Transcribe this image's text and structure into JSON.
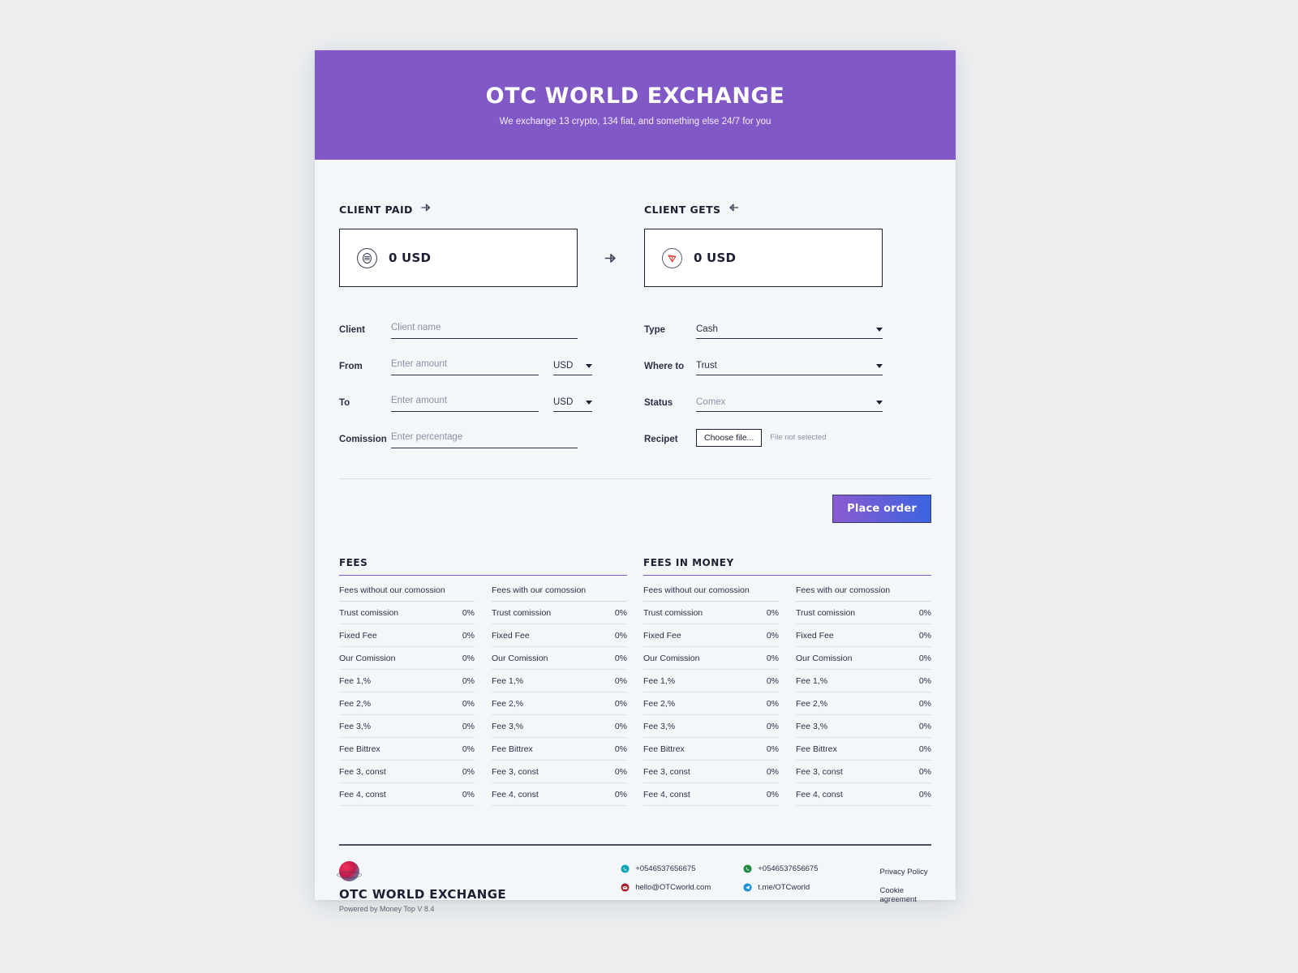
{
  "hero": {
    "title": "OTC WORLD EXCHANGE",
    "subtitle": "We exchange 13 crypto, 134 fiat, and something else 24/7 for you",
    "bg_color": "#8059c7"
  },
  "exchange": {
    "paid": {
      "label": "CLIENT PAID",
      "icon": "arrow-right-icon",
      "coin_icon": "stack-coin-icon",
      "amount": "0 USD"
    },
    "gets": {
      "label": "CLIENT GETS",
      "icon": "arrow-left-icon",
      "coin_icon": "tron-trx-icon",
      "amount": "0 USD"
    },
    "swap_icon": "arrow-right-icon"
  },
  "form_left": [
    {
      "label": "Client",
      "placeholder": "Client name",
      "value": "",
      "unit": null
    },
    {
      "label": "From",
      "placeholder": "Enter amount",
      "value": "",
      "unit": "USD"
    },
    {
      "label": "To",
      "placeholder": "Enter amount",
      "value": "",
      "unit": "USD"
    },
    {
      "label": "Comission",
      "placeholder": "Enter percentage",
      "value": "",
      "unit": null
    }
  ],
  "form_right": {
    "type": {
      "label": "Type",
      "value": "Cash"
    },
    "where_to": {
      "label": "Where to",
      "value": "Trust"
    },
    "status": {
      "label": "Status",
      "value": "Comex"
    },
    "recipet": {
      "label": "Recipet",
      "button": "Choose file...",
      "note": "File not selected"
    }
  },
  "actions": {
    "place_order": "Place order",
    "gradient_from": "#8b5bd0",
    "gradient_to": "#3b63e0"
  },
  "fees_sections": [
    {
      "title": "FEES",
      "columns": [
        {
          "header": "Fees without our comossion",
          "rows": [
            {
              "name": "Trust comission",
              "value": "0%"
            },
            {
              "name": "Fixed Fee",
              "value": "0%"
            },
            {
              "name": "Our Comission",
              "value": "0%"
            },
            {
              "name": "Fee 1,%",
              "value": "0%"
            },
            {
              "name": "Fee 2,%",
              "value": "0%"
            },
            {
              "name": "Fee 3,%",
              "value": "0%"
            },
            {
              "name": "Fee Bittrex",
              "value": "0%"
            },
            {
              "name": "Fee 3, const",
              "value": "0%"
            },
            {
              "name": "Fee 4, const",
              "value": "0%"
            }
          ]
        },
        {
          "header": "Fees with our comossion",
          "rows": [
            {
              "name": "Trust comission",
              "value": "0%"
            },
            {
              "name": "Fixed Fee",
              "value": "0%"
            },
            {
              "name": "Our Comission",
              "value": "0%"
            },
            {
              "name": "Fee 1,%",
              "value": "0%"
            },
            {
              "name": "Fee 2,%",
              "value": "0%"
            },
            {
              "name": "Fee 3,%",
              "value": "0%"
            },
            {
              "name": "Fee Bittrex",
              "value": "0%"
            },
            {
              "name": "Fee 3, const",
              "value": "0%"
            },
            {
              "name": "Fee 4, const",
              "value": "0%"
            }
          ]
        }
      ]
    },
    {
      "title": "FEES IN MONEY",
      "columns": [
        {
          "header": "Fees without our comossion",
          "rows": [
            {
              "name": "Trust comission",
              "value": "0%"
            },
            {
              "name": "Fixed Fee",
              "value": "0%"
            },
            {
              "name": "Our Comission",
              "value": "0%"
            },
            {
              "name": "Fee 1,%",
              "value": "0%"
            },
            {
              "name": "Fee 2,%",
              "value": "0%"
            },
            {
              "name": "Fee 3,%",
              "value": "0%"
            },
            {
              "name": "Fee Bittrex",
              "value": "0%"
            },
            {
              "name": "Fee 3, const",
              "value": "0%"
            },
            {
              "name": "Fee 4, const",
              "value": "0%"
            }
          ]
        },
        {
          "header": "Fees with our comossion",
          "rows": [
            {
              "name": "Trust comission",
              "value": "0%"
            },
            {
              "name": "Fixed Fee",
              "value": "0%"
            },
            {
              "name": "Our Comission",
              "value": "0%"
            },
            {
              "name": "Fee 1,%",
              "value": "0%"
            },
            {
              "name": "Fee 2,%",
              "value": "0%"
            },
            {
              "name": "Fee 3,%",
              "value": "0%"
            },
            {
              "name": "Fee Bittrex",
              "value": "0%"
            },
            {
              "name": "Fee 3, const",
              "value": "0%"
            },
            {
              "name": "Fee 4, const",
              "value": "0%"
            }
          ]
        }
      ]
    }
  ],
  "footer": {
    "brand_name": "OTC WORLD EXCHANGE",
    "powered_by": "Powered by Money Top V 8.4",
    "logo_icon": "globe-logo-icon",
    "contacts_col1": [
      {
        "icon": "phone-icon",
        "icon_color": "#12a5b5",
        "text": "+0546537656675"
      },
      {
        "icon": "mail-icon",
        "icon_color": "#a41f2e",
        "text": "hello@OTCworld.com"
      }
    ],
    "contacts_col2": [
      {
        "icon": "whatsapp-icon",
        "icon_color": "#1f8a43",
        "text": "+0546537656675"
      },
      {
        "icon": "telegram-icon",
        "icon_color": "#1b8fd6",
        "text": "t.me/OTCworld"
      }
    ],
    "links": [
      "Privacy Policy",
      "Cookie agreement"
    ]
  }
}
